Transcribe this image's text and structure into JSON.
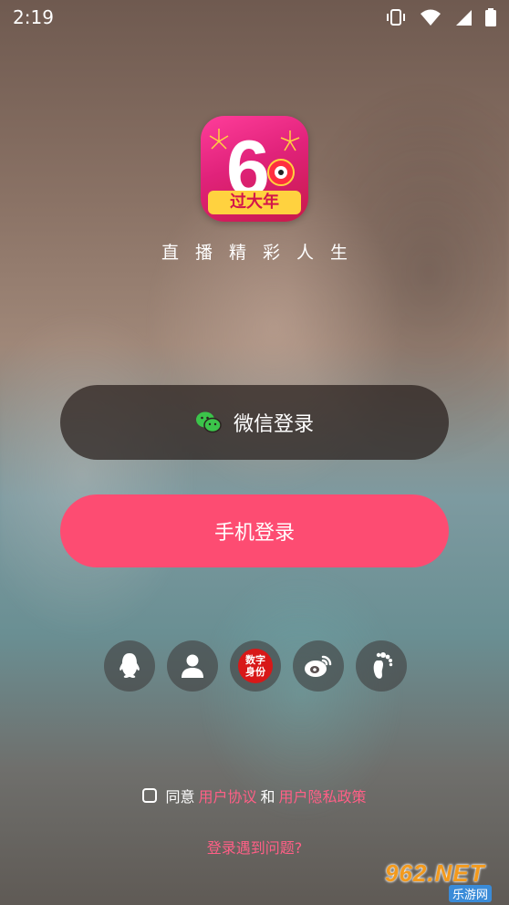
{
  "status_bar": {
    "time": "2:19"
  },
  "logo": {
    "glyph": "6",
    "banner_text": "过大年"
  },
  "tagline": "直播精彩人生",
  "buttons": {
    "wechat_login": "微信登录",
    "phone_login": "手机登录"
  },
  "social_login": {
    "items": [
      {
        "name": "qq-icon"
      },
      {
        "name": "account-icon"
      },
      {
        "name": "digital-id-icon",
        "text_line1": "数字",
        "text_line2": "身份"
      },
      {
        "name": "weibo-icon"
      },
      {
        "name": "footprint-icon"
      }
    ]
  },
  "agreement": {
    "prefix": "同意",
    "user_agreement": "用户协议",
    "and": "和",
    "privacy_policy": "用户隐私政策"
  },
  "help_link": "登录遇到问题?",
  "watermark": {
    "main": "962.NET",
    "sub": "乐游网"
  },
  "colors": {
    "accent": "#fd4c72",
    "link": "#ff5f86",
    "wechat_green": "#3bc44a"
  }
}
